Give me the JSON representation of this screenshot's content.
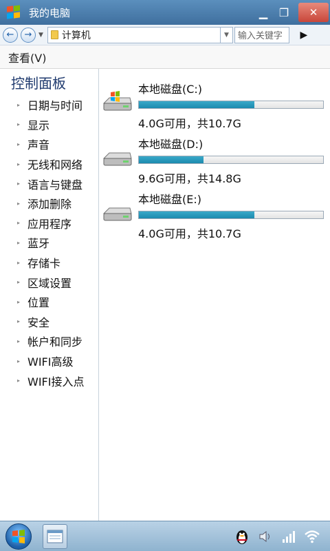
{
  "window": {
    "title": "我的电脑",
    "minimize": "▁",
    "restore": "❐",
    "close": "✕"
  },
  "address": {
    "back": "←",
    "forward": "→",
    "path": "计算机",
    "search_placeholder": "输入关键字",
    "go": "▶"
  },
  "menu": {
    "view": "查看(V)"
  },
  "sidebar": {
    "title": "控制面板",
    "items": [
      {
        "label": "日期与时间"
      },
      {
        "label": "显示"
      },
      {
        "label": "声音"
      },
      {
        "label": "无线和网络"
      },
      {
        "label": "语言与键盘"
      },
      {
        "label": "添加删除"
      },
      {
        "label": "应用程序"
      },
      {
        "label": "蓝牙"
      },
      {
        "label": "存储卡"
      },
      {
        "label": "区域设置"
      },
      {
        "label": "位置"
      },
      {
        "label": "安全"
      },
      {
        "label": "帐户和同步"
      },
      {
        "label": "WIFI高级"
      },
      {
        "label": "WIFI接入点"
      }
    ]
  },
  "drives": [
    {
      "name": "本地磁盘(C:)",
      "free": "4.0G可用，共10.7G",
      "used_fraction": 0.626,
      "system": true
    },
    {
      "name": "本地磁盘(D:)",
      "free": "9.6G可用，共14.8G",
      "used_fraction": 0.351,
      "system": false
    },
    {
      "name": "本地磁盘(E:)",
      "free": "4.0G可用，共10.7G",
      "used_fraction": 0.626,
      "system": false
    }
  ],
  "colors": {
    "titlebar": "#4a7cab",
    "progress": "#1b8aae",
    "taskbar": "#a5c3db"
  }
}
